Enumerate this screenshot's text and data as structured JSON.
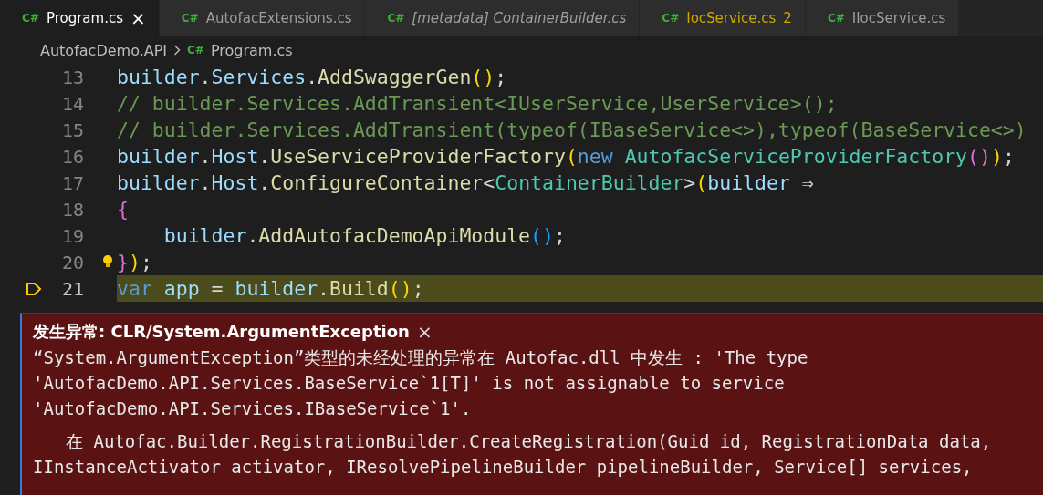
{
  "tabs": [
    {
      "icon": "C#",
      "label": "Program.cs",
      "selected": true,
      "preview": false
    },
    {
      "icon": "C#",
      "label": "AutofacExtensions.cs",
      "selected": false,
      "preview": false
    },
    {
      "icon": "C#",
      "label": "[metadata] ContainerBuilder.cs",
      "selected": false,
      "preview": true
    },
    {
      "icon": "C#",
      "label": "IocService.cs",
      "selected": false,
      "preview": false,
      "problems": "2"
    },
    {
      "icon": "C#",
      "label": "IIocService.cs",
      "selected": false,
      "preview": false
    }
  ],
  "close_tab": "×",
  "breadcrumb": {
    "folder": "AutofacDemo.API",
    "icon": "C#",
    "file": "Program.cs"
  },
  "code_lines": [
    {
      "number": "13",
      "current": false,
      "lightbulb": false,
      "tokens": [
        {
          "text": "builder",
          "kind": "var"
        },
        {
          "text": ".",
          "kind": "punct"
        },
        {
          "text": "Services",
          "kind": "var"
        },
        {
          "text": ".",
          "kind": "punct"
        },
        {
          "text": "AddSwaggerGen",
          "kind": "fn"
        },
        {
          "text": "()",
          "kind": "b1"
        },
        {
          "text": ";",
          "kind": "punct"
        }
      ]
    },
    {
      "number": "14",
      "current": false,
      "lightbulb": false,
      "tokens": [
        {
          "text": "// builder.Services.AddTransient<IUserService,UserService>();",
          "kind": "comment"
        }
      ]
    },
    {
      "number": "15",
      "current": false,
      "lightbulb": false,
      "tokens": [
        {
          "text": "// builder.Services.AddTransient(typeof(IBaseService<>),typeof(BaseService<>)",
          "kind": "comment"
        }
      ]
    },
    {
      "number": "16",
      "current": false,
      "lightbulb": false,
      "tokens": [
        {
          "text": "builder",
          "kind": "var"
        },
        {
          "text": ".",
          "kind": "punct"
        },
        {
          "text": "Host",
          "kind": "var"
        },
        {
          "text": ".",
          "kind": "punct"
        },
        {
          "text": "UseServiceProviderFactory",
          "kind": "fn"
        },
        {
          "text": "(",
          "kind": "b1"
        },
        {
          "text": "new ",
          "kind": "kw"
        },
        {
          "text": "AutofacServiceProviderFactory",
          "kind": "type"
        },
        {
          "text": "()",
          "kind": "b2"
        },
        {
          "text": ")",
          "kind": "b1"
        },
        {
          "text": ";",
          "kind": "punct"
        }
      ]
    },
    {
      "number": "17",
      "current": false,
      "lightbulb": false,
      "tokens": [
        {
          "text": "builder",
          "kind": "var"
        },
        {
          "text": ".",
          "kind": "punct"
        },
        {
          "text": "Host",
          "kind": "var"
        },
        {
          "text": ".",
          "kind": "punct"
        },
        {
          "text": "ConfigureContainer",
          "kind": "fn"
        },
        {
          "text": "<",
          "kind": "punct"
        },
        {
          "text": "ContainerBuilder",
          "kind": "type"
        },
        {
          "text": ">",
          "kind": "punct"
        },
        {
          "text": "(",
          "kind": "b1"
        },
        {
          "text": "builder",
          "kind": "var"
        },
        {
          "text": " ⇒",
          "kind": "punct"
        }
      ]
    },
    {
      "number": "18",
      "current": false,
      "lightbulb": false,
      "tokens": [
        {
          "text": "{",
          "kind": "b2"
        }
      ]
    },
    {
      "number": "19",
      "current": false,
      "lightbulb": false,
      "tokens": [
        {
          "text": "    builder",
          "kind": "var"
        },
        {
          "text": ".",
          "kind": "punct"
        },
        {
          "text": "AddAutofacDemoApiModule",
          "kind": "fn"
        },
        {
          "text": "()",
          "kind": "b3"
        },
        {
          "text": ";",
          "kind": "punct"
        }
      ]
    },
    {
      "number": "20",
      "current": false,
      "lightbulb": true,
      "tokens": [
        {
          "text": "}",
          "kind": "b2"
        },
        {
          "text": ")",
          "kind": "b1"
        },
        {
          "text": ";",
          "kind": "punct"
        }
      ]
    },
    {
      "number": "21",
      "current": true,
      "lightbulb": false,
      "tokens": [
        {
          "text": "var",
          "kind": "kw"
        },
        {
          "text": " app",
          "kind": "var"
        },
        {
          "text": " = ",
          "kind": "punct"
        },
        {
          "text": "builder",
          "kind": "var"
        },
        {
          "text": ".",
          "kind": "punct"
        },
        {
          "text": "Build",
          "kind": "fn"
        },
        {
          "text": "()",
          "kind": "b1"
        },
        {
          "text": ";",
          "kind": "punct"
        }
      ]
    }
  ],
  "exception": {
    "title": "发生异常: CLR/System.ArgumentException",
    "close": "×",
    "message": "“System.ArgumentException”类型的未经处理的异常在 Autofac.dll 中发生 : 'The type 'AutofacDemo.API.Services.BaseService`1[T]' is not assignable to service 'AutofacDemo.API.Services.IBaseService`1'.",
    "stack": "在 Autofac.Builder.RegistrationBuilder.CreateRegistration(Guid id, RegistrationData data, IInstanceActivator activator, IResolvePipelineBuilder pipelineBuilder, Service[] services,"
  }
}
